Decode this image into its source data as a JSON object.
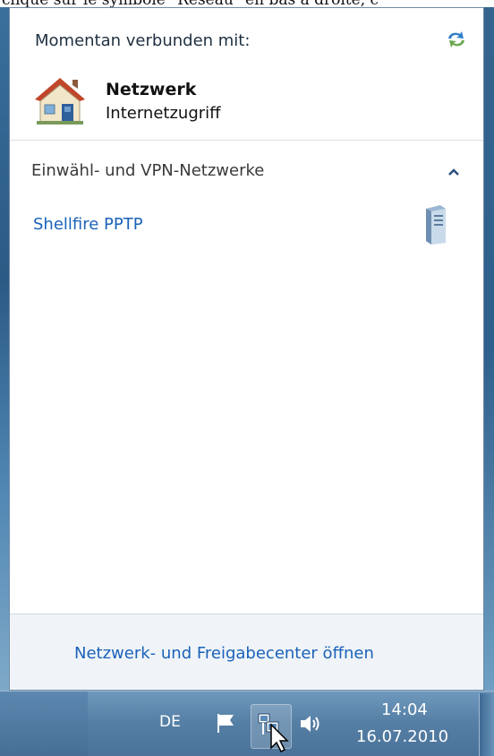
{
  "caption": "cliqué sur le symbole \"Réseau\" en bas à droite, c",
  "popup": {
    "header_title": "Momentan verbunden mit:",
    "network_name": "Netzwerk",
    "network_status": "Internetzugriff",
    "section_title": "Einwähl- und VPN-Netzwerke",
    "vpn_items": [
      "Shellfire PPTP"
    ],
    "footer_link": "Netzwerk- und Freigabecenter öffnen"
  },
  "taskbar": {
    "language": "DE",
    "time": "14:04",
    "date": "16.07.2010"
  },
  "icons": {
    "refresh": "refresh-icon",
    "network_house": "house-icon",
    "collapse": "chevron-up-icon",
    "vpn": "server-icon",
    "action_center": "flag-icon",
    "network_tray": "network-icon",
    "volume": "speaker-icon",
    "pointer": "cursor-icon"
  },
  "colors": {
    "link": "#1a62b8",
    "taskbar": "#557ea4",
    "footer_bg": "#f0f4f8"
  }
}
